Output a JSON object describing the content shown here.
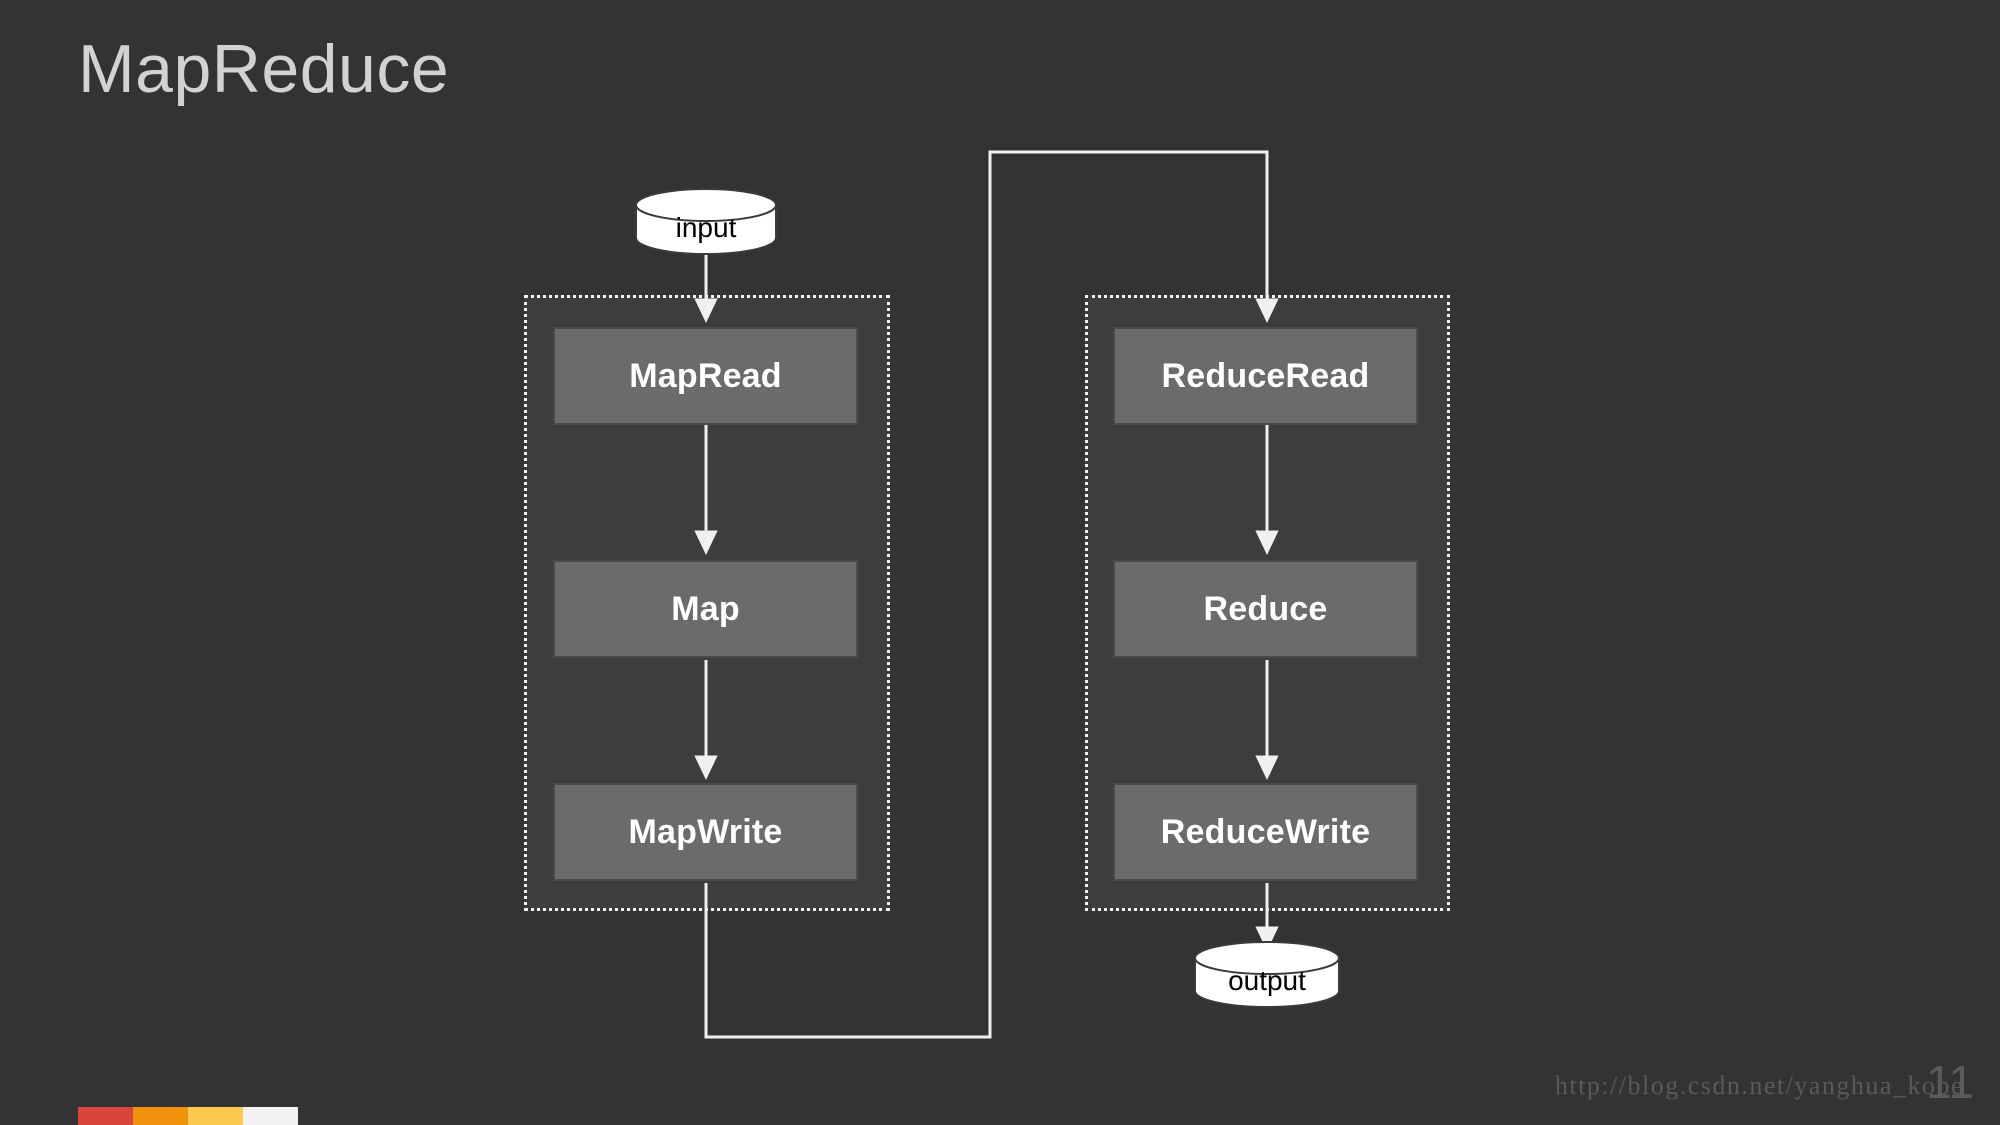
{
  "slide": {
    "title": "MapReduce",
    "background_color": "#333333",
    "title_color": "#d2d2d2",
    "page_number": "11",
    "watermark": "http://blog.csdn.net/yanghua_kobe"
  },
  "accent_bar": {
    "colors": [
      "#d9453c",
      "#f0920b",
      "#fac94e",
      "#f1f1f4"
    ]
  },
  "nodes": {
    "input": {
      "label": "input",
      "shape": "cylinder",
      "fill": "#ffffff",
      "text_color": "#000000"
    },
    "output": {
      "label": "output",
      "shape": "cylinder",
      "fill": "#ffffff",
      "text_color": "#000000"
    },
    "map_read": {
      "label": "MapRead",
      "shape": "rect",
      "fill": "#6b6b6b",
      "text_color": "#ffffff"
    },
    "map": {
      "label": "Map",
      "shape": "rect",
      "fill": "#6b6b6b",
      "text_color": "#ffffff"
    },
    "map_write": {
      "label": "MapWrite",
      "shape": "rect",
      "fill": "#6b6b6b",
      "text_color": "#ffffff"
    },
    "reduce_read": {
      "label": "ReduceRead",
      "shape": "rect",
      "fill": "#6b6b6b",
      "text_color": "#ffffff"
    },
    "reduce": {
      "label": "Reduce",
      "shape": "rect",
      "fill": "#6b6b6b",
      "text_color": "#ffffff"
    },
    "reduce_write": {
      "label": "ReduceWrite",
      "shape": "rect",
      "fill": "#6b6b6b",
      "text_color": "#ffffff"
    }
  },
  "groups": {
    "map_group": {
      "label": "",
      "border_style": "dotted",
      "border_color": "#f2f2f2"
    },
    "reduce_group": {
      "label": "",
      "border_style": "dotted",
      "border_color": "#f2f2f2"
    }
  },
  "edges": [
    {
      "from": "input",
      "to": "map_read",
      "label": ""
    },
    {
      "from": "map_read",
      "to": "map",
      "label": ""
    },
    {
      "from": "map",
      "to": "map_write",
      "label": ""
    },
    {
      "from": "map_write",
      "to": "reduce_read",
      "label": ""
    },
    {
      "from": "reduce_read",
      "to": "reduce",
      "label": ""
    },
    {
      "from": "reduce",
      "to": "reduce_write",
      "label": ""
    },
    {
      "from": "reduce_write",
      "to": "output",
      "label": ""
    }
  ],
  "edge_color": "#f0f0f0"
}
